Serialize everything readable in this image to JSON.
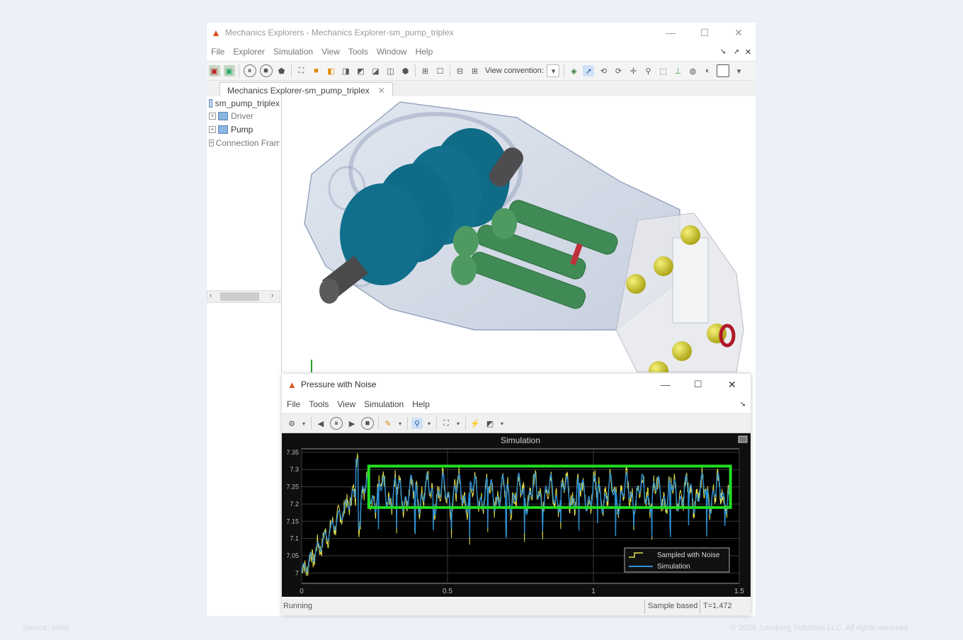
{
  "main_window": {
    "title": "Mechanics Explorers - Mechanics Explorer-sm_pump_triplex",
    "menu": [
      "File",
      "Explorer",
      "Simulation",
      "View",
      "Tools",
      "Window",
      "Help"
    ],
    "view_convention_label": "View convention:",
    "tab_label": "Mechanics Explorer-sm_pump_triplex",
    "tree": {
      "root": "sm_pump_triplex",
      "children": [
        "Driver",
        "Pump",
        "Connection Frames"
      ]
    }
  },
  "scope": {
    "title": "Pressure with Noise",
    "menu": [
      "File",
      "Tools",
      "View",
      "Simulation",
      "Help"
    ],
    "status_left": "Running",
    "status_mode": "Sample based",
    "status_time": "T=1.472"
  },
  "chart_data": {
    "type": "line",
    "title": "Simulation",
    "xlim": [
      0,
      1.5
    ],
    "ylim": [
      6.97,
      7.36
    ],
    "x_ticks": [
      "0",
      "0.5",
      "1",
      "1.5"
    ],
    "y_ticks": [
      "7.35",
      "7.3",
      "7.25",
      "7.2",
      "7.15",
      "7.1",
      "7.05",
      "7"
    ],
    "legend": [
      "Sampled with Noise",
      "Simulation"
    ],
    "legend_position": "bottom-right",
    "highlight_box": {
      "x": [
        0.23,
        1.47
      ],
      "y": [
        7.19,
        7.31
      ],
      "color": "#22dd22"
    },
    "series_colors": [
      "#e6e04a",
      "#2a8fd6"
    ],
    "grid": true
  },
  "colors": {
    "accent": "#0072bd",
    "highlight": "#22dd22"
  },
  "footer": {
    "source": "Source: Imho",
    "copyright": "© 2024. Lemberg Solutions LLC. All rights reserved"
  }
}
